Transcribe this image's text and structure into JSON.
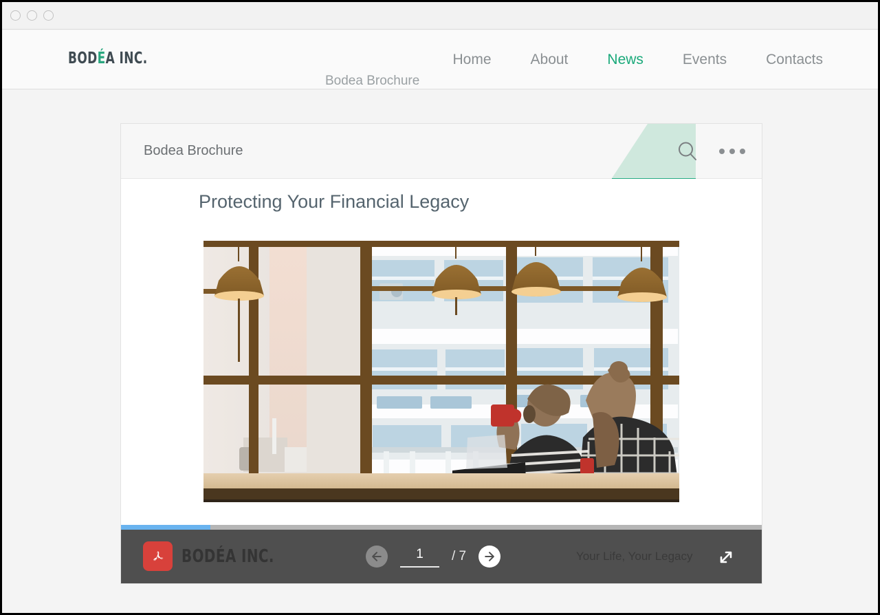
{
  "window": {
    "traffic_lights": [
      "minimize",
      "maximize",
      "close"
    ]
  },
  "site": {
    "brand_prefix": "BOD",
    "brand_accent": "É",
    "brand_suffix": "A INC.",
    "brand_full": "BODÉA INC.",
    "nav": [
      {
        "label": "Home",
        "active": false
      },
      {
        "label": "About",
        "active": false
      },
      {
        "label": "News",
        "active": true
      },
      {
        "label": "Events",
        "active": false
      },
      {
        "label": "Contacts",
        "active": false
      }
    ],
    "clipped_text": "Bodea Brochure"
  },
  "viewer": {
    "title": "Bodea Brochure",
    "search_icon": "search-icon",
    "more_icon": "more-options-icon",
    "ribbon_color_light": "#cfe8dd",
    "ribbon_color_solid": "#27ab84"
  },
  "document": {
    "heading": "Protecting Your Financial Legacy",
    "image_alt": "Two people at a cafe window with pendant lamps and city buildings"
  },
  "progress": {
    "percent": 14,
    "fill_color": "#69b3ef",
    "track_color": "#b5b5b5"
  },
  "toolbar": {
    "pdf_icon": "adobe-acrobat-icon",
    "brand": "BODÉA INC.",
    "prev_label": "Previous page",
    "next_label": "Next page",
    "current_page": "1",
    "total_pages": "/ 7",
    "tagline": "Your Life, Your Legacy",
    "expand_label": "Full screen",
    "background": "#4f4f4f"
  }
}
